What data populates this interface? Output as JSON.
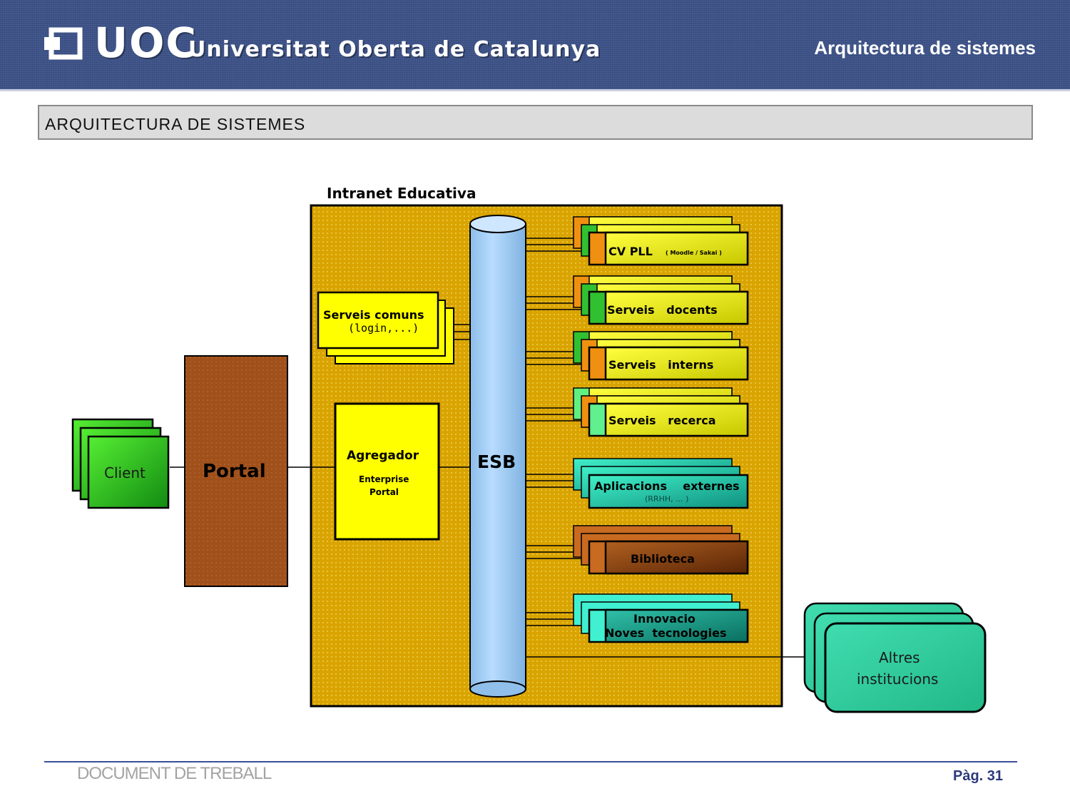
{
  "header": {
    "logo_short": "UOC",
    "logo_name": "Universitat Oberta de Catalunya",
    "title": "Arquitectura de sistemes"
  },
  "section": {
    "title": "ARQUITECTURA DE SISTEMES"
  },
  "diagram": {
    "intranet_label": "Intranet Educativa",
    "client": "Client",
    "portal": "Portal",
    "serveis_comuns": {
      "line1": "Serveis  comuns",
      "line2": "(login,...)"
    },
    "agregador": {
      "title": "Agregador",
      "line1": "Enterprise",
      "line2": "Portal"
    },
    "esb": "ESB",
    "services": [
      {
        "label": "CV PLL",
        "sub": "( Moodle   / Sakai  )"
      },
      {
        "label": "Serveis   docents",
        "sub": ""
      },
      {
        "label": "Serveis   interns",
        "sub": ""
      },
      {
        "label": "Serveis   recerca",
        "sub": ""
      },
      {
        "label": "Aplicacions    externes",
        "sub": "(RRHH, ... )"
      },
      {
        "label": "Biblioteca",
        "sub": ""
      },
      {
        "label": "Innovacio",
        "sub": "Noves  tecnologies"
      }
    ],
    "altres": {
      "line1": "Altres",
      "line2": "institucions"
    }
  },
  "footer": {
    "doc": "DOCUMENT DE TREBALL",
    "page": "Pàg. 31"
  },
  "colors": {
    "header_bg": "#3d5288",
    "intranet_bg": "#d9a400",
    "portal_bg": "#a0501a",
    "esb_bg": "#a6cdf5",
    "client_bg": "#22b022",
    "box_yellow": "#ffff00",
    "aplicacions_bg": "#20d9b0",
    "biblioteca_bg": "#8a3a0f",
    "innovacio_bg": "#18a088",
    "altres_bg": "#3dd4a0"
  }
}
